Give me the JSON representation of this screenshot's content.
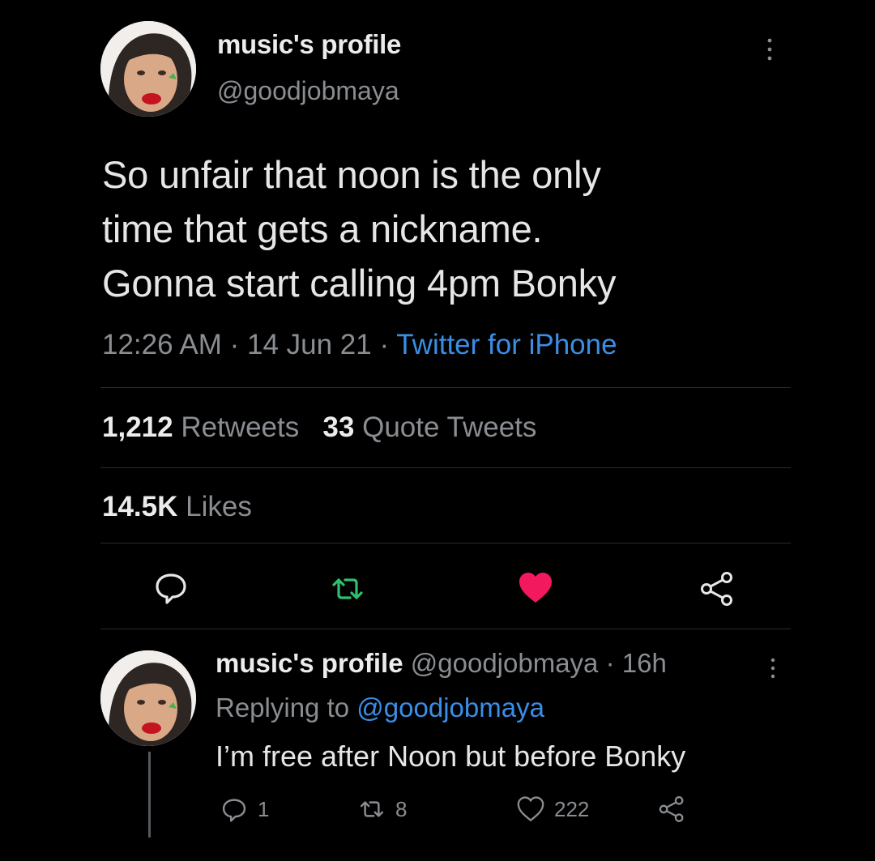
{
  "main_tweet": {
    "author_name": "music's profile",
    "handle": "@goodjobmaya",
    "text_lines": [
      "So unfair that noon is the only",
      "time that gets a nickname.",
      "Gonna start calling 4pm Bonky"
    ],
    "time": "12:26 AM",
    "date": "14 Jun 21",
    "separator": " · ",
    "source": "Twitter for iPhone",
    "retweets_count": "1,212",
    "retweets_label": "Retweets",
    "quote_count": "33",
    "quote_label": "Quote Tweets",
    "likes_count": "14.5K",
    "likes_label": "Likes",
    "icons": [
      "reply-icon",
      "retweet-icon",
      "heart-filled-icon",
      "share-icon",
      "more-vertical-icon"
    ],
    "colors": {
      "retweet": "#2fbf71",
      "like": "#f3195f",
      "link": "#3a8ee6"
    }
  },
  "reply": {
    "author_name": "music's profile",
    "handle": "@goodjobmaya",
    "separator": " · ",
    "age": "16h",
    "replying_label": "Replying to",
    "replying_mention": "@goodjobmaya",
    "text": "I’m free after Noon but before Bonky",
    "reply_count": "1",
    "retweet_count": "8",
    "like_count": "222",
    "icons": [
      "reply-icon",
      "retweet-icon",
      "heart-outline-icon",
      "share-icon",
      "more-vertical-icon"
    ]
  }
}
